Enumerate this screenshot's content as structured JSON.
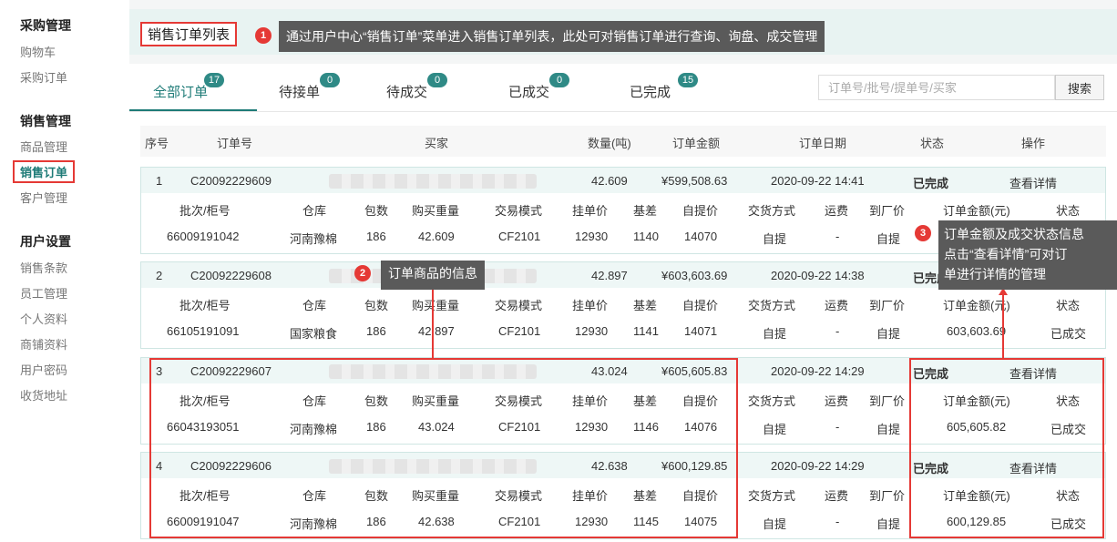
{
  "sidebar": {
    "sections": [
      {
        "title": "采购管理",
        "items": [
          "购物车",
          "采购订单"
        ]
      },
      {
        "title": "销售管理",
        "items": [
          "商品管理",
          "销售订单",
          "客户管理"
        ]
      },
      {
        "title": "用户设置",
        "items": [
          "销售条款",
          "员工管理",
          "个人资料",
          "商铺资料",
          "用户密码",
          "收货地址"
        ]
      }
    ],
    "active_item": "销售订单"
  },
  "page_title": "销售订单列表",
  "annotations": {
    "a1": {
      "num": "1",
      "text": "通过用户中心“销售订单”菜单进入销售订单列表，此处可对销售订单进行查询、询盘、成交管理"
    },
    "a2": {
      "num": "2",
      "text": "订单商品的信息"
    },
    "a3": {
      "num": "3",
      "line1": "订单金额及成交状态信息",
      "line2": "点击“查看详情”可对订",
      "line3": "单进行详情的管理"
    }
  },
  "tabs": [
    {
      "label": "全部订单",
      "count": "17",
      "active": true
    },
    {
      "label": "待接单",
      "count": "0"
    },
    {
      "label": "待成交",
      "count": "0"
    },
    {
      "label": "已成交",
      "count": "0"
    },
    {
      "label": "已完成",
      "count": "15"
    }
  ],
  "search": {
    "placeholder": "订单号/批号/提单号/买家",
    "button": "搜索"
  },
  "list_headers": [
    "序号",
    "订单号",
    "买家",
    "数量(吨)",
    "订单金额",
    "订单日期",
    "状态",
    "操作"
  ],
  "detail_headers": [
    "批次/柜号",
    "仓库",
    "包数",
    "购买重量",
    "交易模式",
    "挂单价",
    "基差",
    "自提价",
    "交货方式",
    "运费",
    "到厂价",
    "订单金额(元)",
    "状态"
  ],
  "orders": [
    {
      "seq": "1",
      "order_no": "C20092229609",
      "qty": "42.609",
      "amount": "¥599,508.63",
      "date": "2020-09-22 14:41",
      "status": "已完成",
      "action": "查看详情",
      "detail": {
        "batch": "66009191042",
        "warehouse": "河南豫棉",
        "packs": "186",
        "weight": "42.609",
        "mode": "CF2101",
        "list_price": "12930",
        "basis": "1140",
        "pickup_price": "14070",
        "delivery": "自提",
        "freight": "-",
        "factory_price": "自提",
        "total": "",
        "status": ""
      }
    },
    {
      "seq": "2",
      "order_no": "C20092229608",
      "qty": "42.897",
      "amount": "¥603,603.69",
      "date": "2020-09-22 14:38",
      "status": "已完成",
      "action": "",
      "detail": {
        "batch": "66105191091",
        "warehouse": "国家粮食",
        "packs": "186",
        "weight": "42.897",
        "mode": "CF2101",
        "list_price": "12930",
        "basis": "1141",
        "pickup_price": "14071",
        "delivery": "自提",
        "freight": "-",
        "factory_price": "自提",
        "total": "603,603.69",
        "status": "已成交"
      }
    },
    {
      "seq": "3",
      "order_no": "C20092229607",
      "qty": "43.024",
      "amount": "¥605,605.83",
      "date": "2020-09-22 14:29",
      "status": "已完成",
      "action": "查看详情",
      "detail": {
        "batch": "66043193051",
        "warehouse": "河南豫棉",
        "packs": "186",
        "weight": "43.024",
        "mode": "CF2101",
        "list_price": "12930",
        "basis": "1146",
        "pickup_price": "14076",
        "delivery": "自提",
        "freight": "-",
        "factory_price": "自提",
        "total": "605,605.82",
        "status": "已成交"
      }
    },
    {
      "seq": "4",
      "order_no": "C20092229606",
      "qty": "42.638",
      "amount": "¥600,129.85",
      "date": "2020-09-22 14:29",
      "status": "已完成",
      "action": "查看详情",
      "detail": {
        "batch": "66009191047",
        "warehouse": "河南豫棉",
        "packs": "186",
        "weight": "42.638",
        "mode": "CF2101",
        "list_price": "12930",
        "basis": "1145",
        "pickup_price": "14075",
        "delivery": "自提",
        "freight": "-",
        "factory_price": "自提",
        "total": "600,129.85",
        "status": "已成交"
      }
    }
  ],
  "colors": {
    "accent": "#1e7b77",
    "highlight": "#e53935",
    "callout_bg": "#5a5a5a"
  }
}
